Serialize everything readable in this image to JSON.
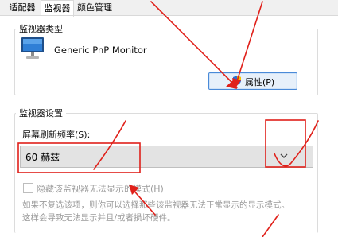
{
  "tabs": [
    {
      "label": "适配器"
    },
    {
      "label": "监视器"
    },
    {
      "label": "颜色管理"
    }
  ],
  "monitor_type_group": {
    "title": "监视器类型",
    "monitor_name": "Generic PnP Monitor",
    "properties_button": "属性(P)"
  },
  "monitor_settings_group": {
    "title": "监视器设置",
    "refresh_label": "屏幕刷新频率(S):",
    "refresh_value": "60 赫兹",
    "hide_modes_checkbox": "隐藏该监视器无法显示的模式(H)",
    "hint_line_1": "如果不复选该项，则你可以选择那些该监视器无法正常显示的显示模式。",
    "hint_line_2": "这样会导致无法显示并且/或者损坏硬件。"
  },
  "colors": {
    "annotation_red": "#e0201a",
    "button_border": "#4a8ad8",
    "button_fill": "#e7f0fa"
  },
  "icons": [
    "monitor-icon",
    "shield-icon",
    "chevron-down-icon",
    "checkbox"
  ]
}
